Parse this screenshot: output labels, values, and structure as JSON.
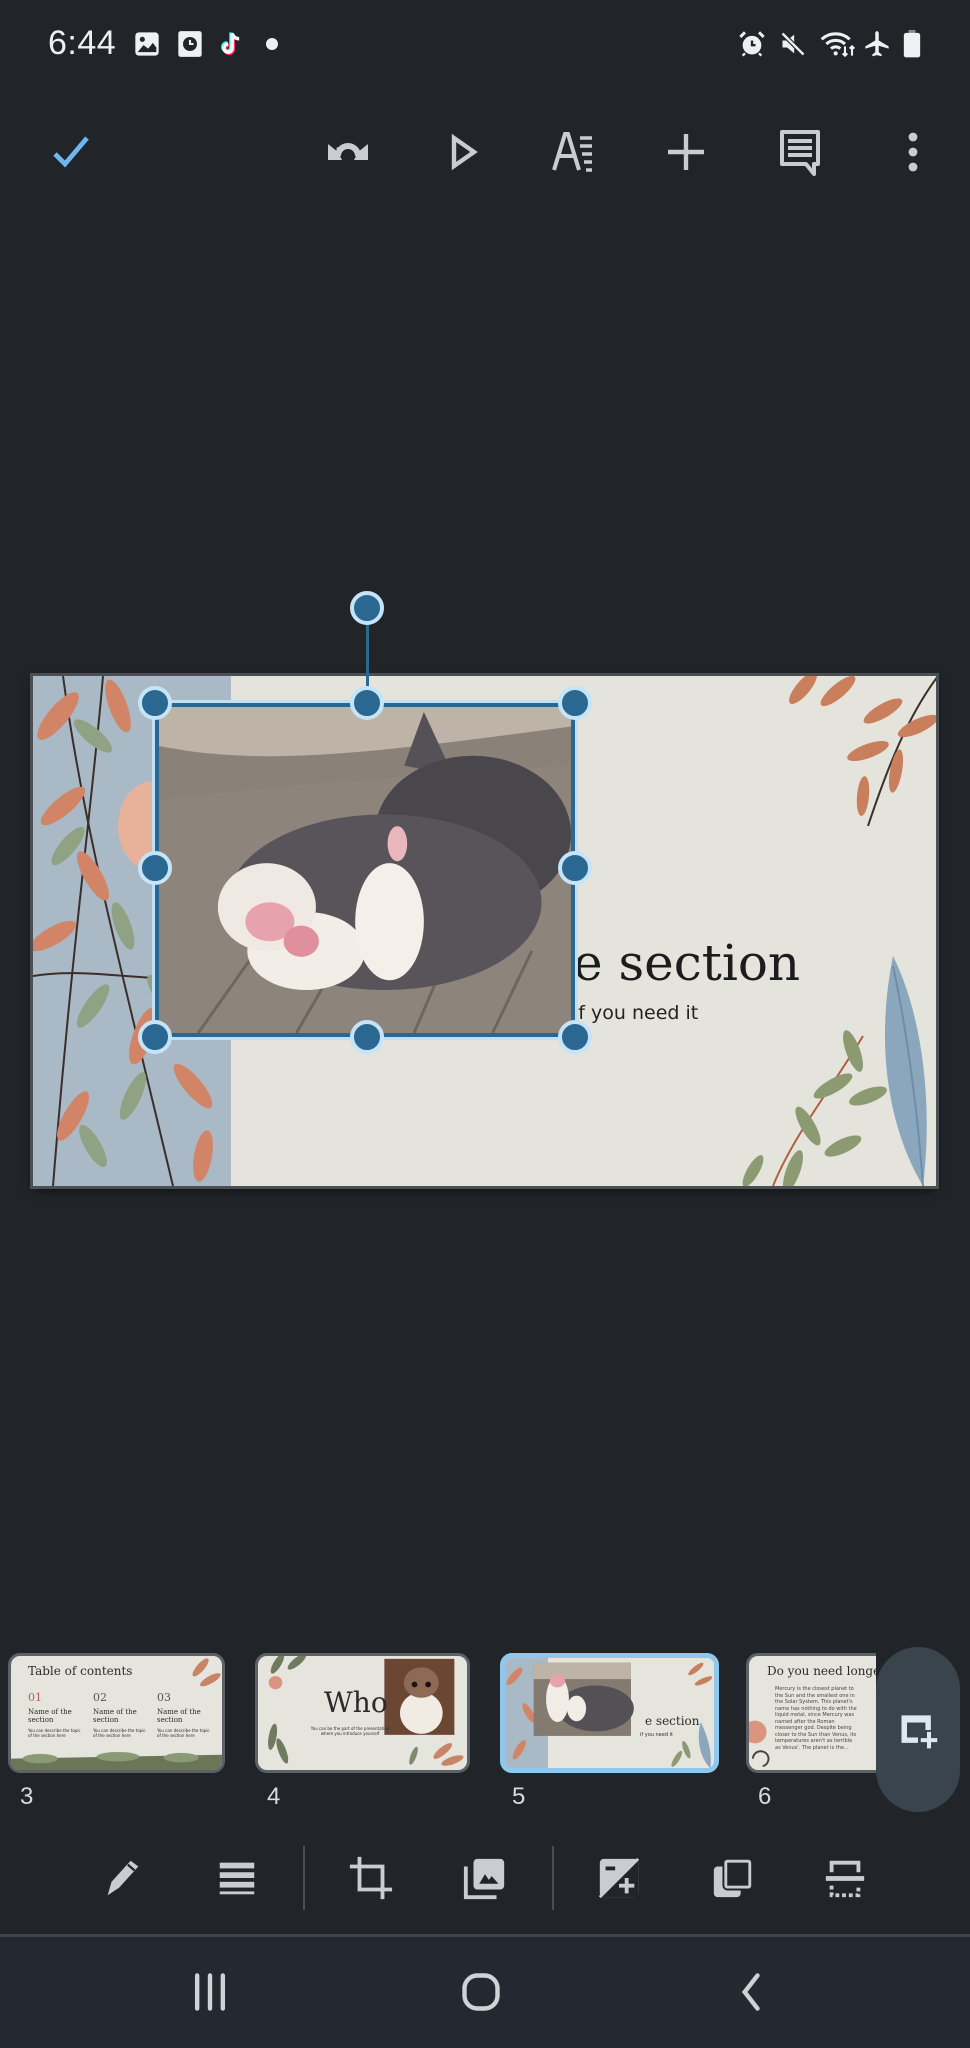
{
  "status_bar": {
    "time": "6:44",
    "left_icons": [
      "gallery-notification-icon",
      "clock-notification-icon",
      "tiktok-icon",
      "more-notifications-dot"
    ],
    "right_icons": [
      "alarm-icon",
      "mute-icon",
      "wifi-icon",
      "airplane-mode-icon",
      "battery-icon"
    ]
  },
  "toolbar": {
    "done": "Done",
    "undo": "Undo",
    "present": "Present",
    "format": "Format",
    "insert": "Insert",
    "comments": "Comments",
    "more": "More options",
    "accent": "#6cb7ef"
  },
  "slide": {
    "title": "e section",
    "subtitle": "if you need it",
    "background": "#e4e4dc",
    "selection_color": "#2a6892"
  },
  "filmstrip": {
    "selected_index": 2,
    "slides": [
      {
        "number": "3",
        "title": "Table of contents",
        "items": [
          {
            "num": "01",
            "name": "Name of the section",
            "desc": "You can describe the topic of the section here"
          },
          {
            "num": "02",
            "name": "Name of the section",
            "desc": "You can describe the topic of the section here"
          },
          {
            "num": "03",
            "name": "Name of the section",
            "desc": "You can describe the topic of the section here"
          }
        ]
      },
      {
        "number": "4",
        "title": "Who",
        "desc": "You can be the part of the presentation where you introduce yourself"
      },
      {
        "number": "5",
        "title": "e section",
        "desc": "if you need it"
      },
      {
        "number": "6",
        "title": "Do you need longer t",
        "desc": "Mercury is the closest planet to the Sun and the smallest one in the Solar System. This planet's name has nothing to do with the liquid metal, since Mercury was named after the Roman messenger god. Despite being closer to the Sun than Venus, its temperatures aren't as terrible as Venus'. The planet is the..."
      }
    ],
    "add_slide": "New slide"
  },
  "format_bar": {
    "items": [
      "Edit",
      "Alt text",
      "Crop",
      "Replace image",
      "Adjustments",
      "Arrange",
      "Align"
    ]
  },
  "nav_bar": {
    "recents": "Recent apps",
    "home": "Home",
    "back": "Back"
  }
}
